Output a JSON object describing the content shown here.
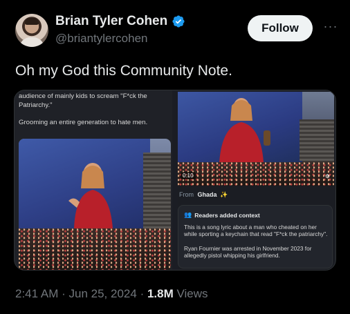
{
  "author": {
    "name": "Brian Tyler Cohen",
    "handle": "@briantylercohen",
    "verified_icon": "verified-badge-icon",
    "verified_color": "#1d9bf0"
  },
  "actions": {
    "follow_label": "Follow",
    "more_label": "···"
  },
  "tweet": {
    "text": "Oh my God this Community Note."
  },
  "media": {
    "left_text_line1": "audience of mainly kids to scream \"F*ck the Patriarchy.\"",
    "left_text_line2": "Grooming an entire generation to hate men.",
    "video_time": "0:10",
    "from_label": "From",
    "from_author": "Ghada",
    "from_emoji": "✨",
    "note_title": "Readers added context",
    "note_p1": "This is a song lyric about a man who cheated on her while sporting a keychain that read \"F*ck the patriarchy\".",
    "note_p2": "Ryan Fournier was arrested in November 2023 for allegedly pistol whipping his girlfriend."
  },
  "meta": {
    "time": "2:41 AM",
    "separator": "·",
    "date": "Jun 25, 2024",
    "views_count": "1.8M",
    "views_label": "Views"
  }
}
